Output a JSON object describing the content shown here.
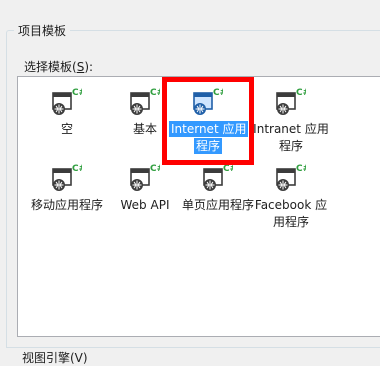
{
  "group": {
    "title": "项目模板"
  },
  "template_label": {
    "text": "选择模板(",
    "access_key": "S",
    "suffix": "):"
  },
  "templates": [
    {
      "label": "空",
      "selected": false,
      "icon": "csharp-project-template-icon"
    },
    {
      "label": "基本",
      "selected": false,
      "icon": "csharp-project-template-icon"
    },
    {
      "label": "Internet 应用程序",
      "selected": true,
      "icon": "csharp-web-project-template-icon"
    },
    {
      "label": "Intranet 应用程序",
      "selected": false,
      "icon": "csharp-web-project-template-icon"
    },
    {
      "label": "移动应用程序",
      "selected": false,
      "icon": "csharp-web-project-template-icon"
    },
    {
      "label": "Web API",
      "selected": false,
      "icon": "csharp-web-project-template-icon"
    },
    {
      "label": "单页应用程序",
      "selected": false,
      "icon": "csharp-web-project-template-icon"
    },
    {
      "label": "Facebook 应用程序",
      "selected": false,
      "icon": "csharp-web-project-template-icon"
    }
  ],
  "bottom": {
    "text": "视图引擎(V)"
  },
  "colors": {
    "selection": "#3399ff",
    "highlight_frame": "#ff0000",
    "csharp_badge": "#2f9e3e"
  }
}
